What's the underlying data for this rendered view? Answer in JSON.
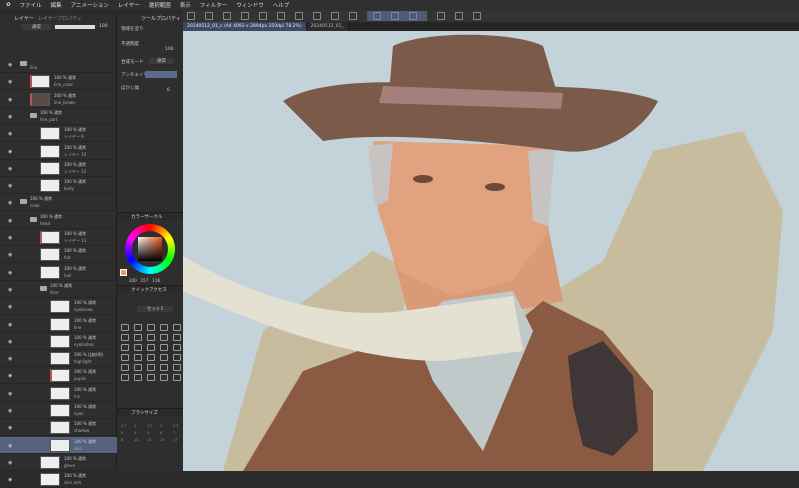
{
  "menu": [
    "ファイル",
    "編集",
    "アニメーション",
    "レイヤー",
    "選択範囲",
    "表示",
    "フィルター",
    "ウィンドウ",
    "ヘルプ"
  ],
  "tabs": [
    {
      "label": "20240512_01_c (A4 4093 x 2894px 350dpi 78.2%)",
      "active": true
    },
    {
      "label": "20240512_01_",
      "active": false
    }
  ],
  "layer_panel": {
    "tab_layer": "レイヤー",
    "tab_props": "レイヤープロパティ",
    "blend": "通常",
    "opacity": "100"
  },
  "layers": [
    {
      "mode": "",
      "name": "line",
      "folder": true,
      "indent": 0
    },
    {
      "mode": "100 % 通常",
      "name": "line_color",
      "indent": 1,
      "clip": true
    },
    {
      "mode": "100 % 通常",
      "name": "line_brown",
      "indent": 1,
      "clip": true,
      "dark": true
    },
    {
      "mode": "100 % 通常",
      "name": "line_part",
      "folder": true,
      "indent": 1
    },
    {
      "mode": "100 % 通常",
      "name": "レイヤー 9",
      "indent": 2
    },
    {
      "mode": "100 % 通常",
      "name": "レイヤー 10",
      "indent": 2
    },
    {
      "mode": "100 % 通常",
      "name": "レイヤー 12",
      "indent": 2
    },
    {
      "mode": "100 % 通常",
      "name": "body",
      "indent": 2
    },
    {
      "mode": "100 % 通常",
      "name": "color",
      "folder": true,
      "indent": 0
    },
    {
      "mode": "100 % 通常",
      "name": "head",
      "folder": true,
      "indent": 1
    },
    {
      "mode": "100 % 通常",
      "name": "レイヤー 13",
      "indent": 2,
      "clip": true
    },
    {
      "mode": "100 % 通常",
      "name": "hat",
      "indent": 2
    },
    {
      "mode": "100 % 通常",
      "name": "hair",
      "indent": 2
    },
    {
      "mode": "100 % 通常",
      "name": "face",
      "folder": true,
      "indent": 2
    },
    {
      "mode": "100 % 通常",
      "name": "eyebrows",
      "indent": 3
    },
    {
      "mode": "100 % 通常",
      "name": "line",
      "indent": 3
    },
    {
      "mode": "100 % 通常",
      "name": "eyelashes",
      "indent": 3
    },
    {
      "mode": "100 % 比較(明)",
      "name": "highlight",
      "indent": 3
    },
    {
      "mode": "100 % 通常",
      "name": "pupils",
      "indent": 3,
      "clip": true
    },
    {
      "mode": "100 % 通常",
      "name": "iris",
      "indent": 3
    },
    {
      "mode": "100 % 通常",
      "name": "eyes",
      "indent": 3
    },
    {
      "mode": "100 % 通常",
      "name": "shadow",
      "indent": 3
    },
    {
      "mode": "100 % 通常",
      "name": "skin",
      "indent": 3,
      "selected": true
    },
    {
      "mode": "100 % 通常",
      "name": "glove",
      "indent": 2
    },
    {
      "mode": "100 % 通常",
      "name": "skin arm",
      "indent": 2
    }
  ],
  "tool_property": {
    "title": "ツールプロパティ",
    "tool": "領域を塗り",
    "opacity_label": "不透明度",
    "opacity": "100",
    "blend_label": "合成モード",
    "blend": "通常",
    "aa_label": "アンチエイリアス",
    "blur_label": "ぼかし幅",
    "blur": "6"
  },
  "color_circle": {
    "title": "カラーサークル",
    "r": "240",
    "g": "157",
    "b": "118",
    "color": "#f09d76"
  },
  "quick_access": {
    "title": "クイックアクセス",
    "set": "セット1"
  },
  "brush_size": {
    "title": "ブラシサイズ",
    "sizes": [
      "0.7",
      "1",
      "1.5",
      "2",
      "2.5",
      "3",
      "4",
      "5",
      "6",
      "7",
      "8",
      "10",
      "12",
      "15",
      "17"
    ]
  },
  "colors": {
    "sky": "#c3d3d9",
    "hat": "#7b5a4a",
    "band": "#a5807a",
    "skin": "#e0a27f",
    "coat": "#c8bc9f",
    "scarf": "#e4e0d2",
    "jacket": "#8a5a43",
    "glove": "#3f3637",
    "accent": "#4f5a78"
  }
}
